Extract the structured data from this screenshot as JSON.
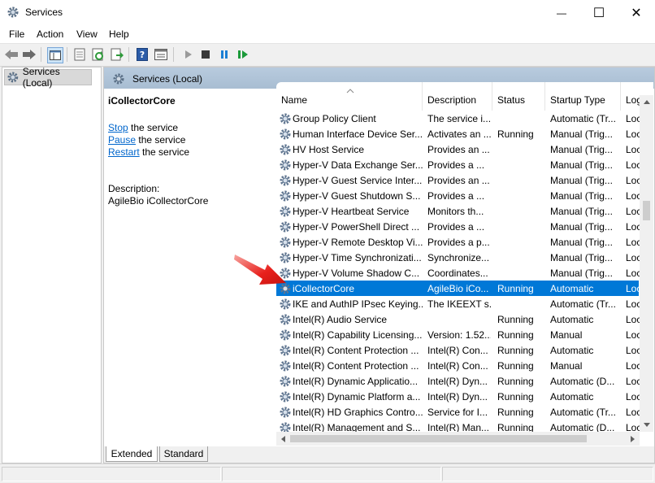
{
  "window": {
    "title": "Services",
    "min_glyph": "—",
    "max_glyph": "☐",
    "close_glyph": "✕"
  },
  "menu": [
    "File",
    "Action",
    "View",
    "Help"
  ],
  "tree": {
    "root_label": "Services (Local)"
  },
  "pane_header": {
    "label": "Services (Local)"
  },
  "extended": {
    "service_name": "iCollectorCore",
    "actions": [
      {
        "link": "Stop",
        "rest": " the service"
      },
      {
        "link": "Pause",
        "rest": " the service"
      },
      {
        "link": "Restart",
        "rest": " the service"
      }
    ],
    "description_label": "Description:",
    "description_text": "AgileBio iCollectorCore"
  },
  "columns": [
    "Name",
    "Description",
    "Status",
    "Startup Type",
    "Log"
  ],
  "rows": [
    {
      "name": "Group Policy Client",
      "description": "The service i...",
      "status": "",
      "startup": "Automatic (Tr...",
      "log": "Loc"
    },
    {
      "name": "Human Interface Device Ser...",
      "description": "Activates an ...",
      "status": "Running",
      "startup": "Manual (Trig...",
      "log": "Loc"
    },
    {
      "name": "HV Host Service",
      "description": "Provides an ...",
      "status": "",
      "startup": "Manual (Trig...",
      "log": "Loc"
    },
    {
      "name": "Hyper-V Data Exchange Ser...",
      "description": "Provides a ...",
      "status": "",
      "startup": "Manual (Trig...",
      "log": "Loc"
    },
    {
      "name": "Hyper-V Guest Service Inter...",
      "description": "Provides an ...",
      "status": "",
      "startup": "Manual (Trig...",
      "log": "Loc"
    },
    {
      "name": "Hyper-V Guest Shutdown S...",
      "description": "Provides a ...",
      "status": "",
      "startup": "Manual (Trig...",
      "log": "Loc"
    },
    {
      "name": "Hyper-V Heartbeat Service",
      "description": "Monitors th...",
      "status": "",
      "startup": "Manual (Trig...",
      "log": "Loc"
    },
    {
      "name": "Hyper-V PowerShell Direct ...",
      "description": "Provides a ...",
      "status": "",
      "startup": "Manual (Trig...",
      "log": "Loc"
    },
    {
      "name": "Hyper-V Remote Desktop Vi...",
      "description": "Provides a p...",
      "status": "",
      "startup": "Manual (Trig...",
      "log": "Loc"
    },
    {
      "name": "Hyper-V Time Synchronizati...",
      "description": "Synchronize...",
      "status": "",
      "startup": "Manual (Trig...",
      "log": "Loc"
    },
    {
      "name": "Hyper-V Volume Shadow C...",
      "description": "Coordinates...",
      "status": "",
      "startup": "Manual (Trig...",
      "log": "Loc"
    },
    {
      "name": "iCollectorCore",
      "description": "AgileBio iCo...",
      "status": "Running",
      "startup": "Automatic",
      "log": "Loc",
      "selected": true
    },
    {
      "name": "IKE and AuthIP IPsec Keying...",
      "description": "The IKEEXT s...",
      "status": "",
      "startup": "Automatic (Tr...",
      "log": "Loc"
    },
    {
      "name": "Intel(R) Audio Service",
      "description": "",
      "status": "Running",
      "startup": "Automatic",
      "log": "Loc"
    },
    {
      "name": "Intel(R) Capability Licensing...",
      "description": "Version: 1.52...",
      "status": "Running",
      "startup": "Manual",
      "log": "Loc"
    },
    {
      "name": "Intel(R) Content Protection ...",
      "description": "Intel(R) Con...",
      "status": "Running",
      "startup": "Automatic",
      "log": "Loc"
    },
    {
      "name": "Intel(R) Content Protection ...",
      "description": "Intel(R) Con...",
      "status": "Running",
      "startup": "Manual",
      "log": "Loc"
    },
    {
      "name": "Intel(R) Dynamic Applicatio...",
      "description": "Intel(R) Dyn...",
      "status": "Running",
      "startup": "Automatic (D...",
      "log": "Loc"
    },
    {
      "name": "Intel(R) Dynamic Platform a...",
      "description": "Intel(R) Dyn...",
      "status": "Running",
      "startup": "Automatic",
      "log": "Loc"
    },
    {
      "name": "Intel(R) HD Graphics Contro...",
      "description": "Service for I...",
      "status": "Running",
      "startup": "Automatic (Tr...",
      "log": "Loc"
    },
    {
      "name": "Intel(R) Management and S...",
      "description": "Intel(R) Man...",
      "status": "Running",
      "startup": "Automatic (D...",
      "log": "Loc"
    }
  ],
  "tabs": [
    "Extended",
    "Standard"
  ],
  "colors": {
    "selection": "#0078d7",
    "pane_header": "#b8cbde",
    "arrow": "#e8201c",
    "link": "#0066cc"
  },
  "toolbar_icons": [
    "back-arrow-icon",
    "forward-arrow-icon",
    "show-hide-console-tree-icon",
    "properties-icon",
    "refresh-icon",
    "export-list-icon",
    "help-icon",
    "console-view-icon",
    "start-service-icon",
    "stop-service-icon",
    "pause-service-icon",
    "restart-service-icon"
  ]
}
